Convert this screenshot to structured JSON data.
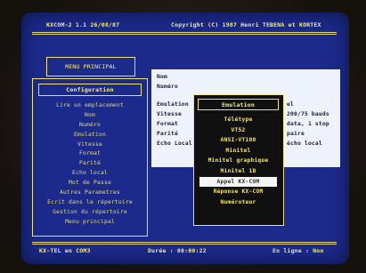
{
  "header": {
    "app_version": "KXCOM-2 1.1 26/08/87",
    "copyright": "Copyright (C) 1987 Henri TEBENA et KORTEX"
  },
  "menu": {
    "title": "MENU PRINCIPAL",
    "selected": "Configuration",
    "items": [
      "Lire un emplacement",
      "Nom",
      "Numéro",
      "Emulation",
      "Vitesse",
      "Format",
      "Parité",
      "Echo local",
      "Mot de Passe",
      "Autres Parametres",
      "Ecrit dans le répertoire",
      "Gestion du répertoire",
      "Menu principal"
    ]
  },
  "form": {
    "labels": {
      "nom": "Nom",
      "numero": "Numéro",
      "emulation": "Emulation",
      "vitesse": "Vitesse",
      "format": "Format",
      "parite": "Parité",
      "echo": "Echo Local"
    },
    "values": {
      "emulation": "el",
      "vitesse": "200/75 bauds",
      "format": "data, 1 stop",
      "parite": "paire",
      "echo": "écho local"
    }
  },
  "emulation_popup": {
    "title": "Emulation",
    "options": [
      "Télétype",
      "VT52",
      "ANSI-VT100",
      "Minitel",
      "Minitel graphique",
      "Minitel 1B",
      "Appel KX-COM",
      "Réponse KX-COM",
      "Numéroteur"
    ],
    "selected_index": 6
  },
  "status_bar": {
    "left": "KX-TEL en COM3",
    "duration": "Durée : 00:00:22",
    "line_state": "En ligne : Non"
  },
  "colors": {
    "screen_bg": "#1c2a8c",
    "text_yellow": "#f0e070",
    "panel_white": "#eef2fa",
    "popup_bg": "#101010"
  }
}
